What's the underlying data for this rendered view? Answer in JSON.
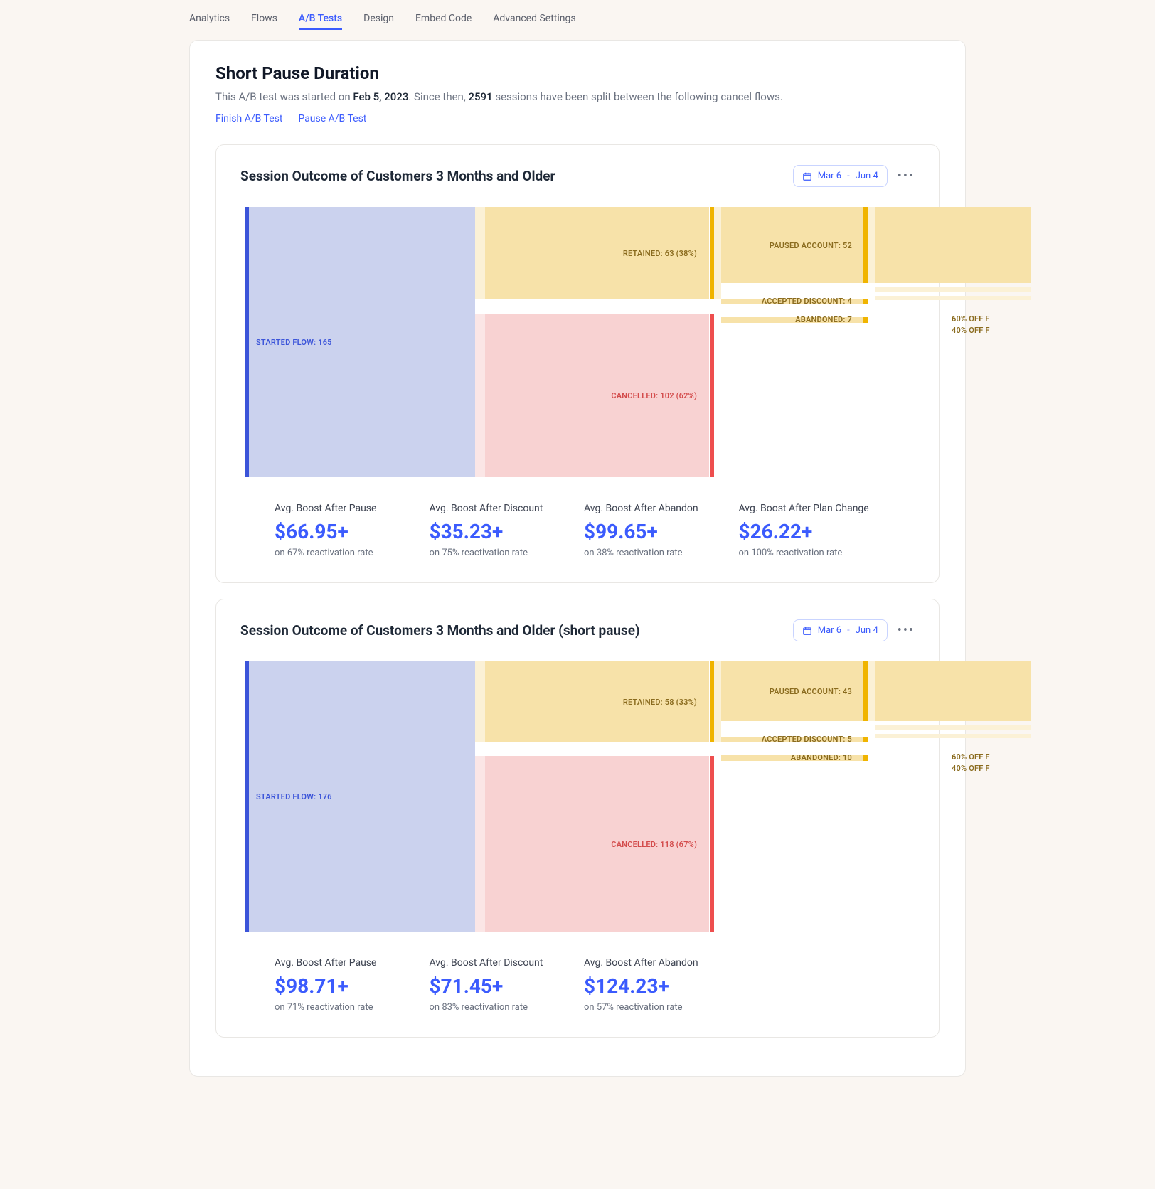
{
  "tabs": {
    "analytics": "Analytics",
    "flows": "Flows",
    "ab_tests": "A/B Tests",
    "design": "Design",
    "embed": "Embed Code",
    "advanced": "Advanced Settings"
  },
  "header": {
    "title": "Short Pause Duration",
    "sub_prefix": "This A/B test was started on ",
    "start_date": "Feb 5, 2023",
    "sub_mid": ". Since then, ",
    "session_count": "2591",
    "sub_suffix": " sessions have been split between the following cancel flows."
  },
  "actions": {
    "finish": "Finish A/B Test",
    "pause": "Pause A/B Test"
  },
  "date_range": {
    "from": "Mar 6",
    "to": "Jun 4",
    "dash": "-"
  },
  "chart_data": [
    {
      "type": "sankey",
      "title": "Session Outcome of Customers 3 Months and Older",
      "started": {
        "label": "STARTED FLOW",
        "value": 165
      },
      "retained": {
        "label": "RETAINED",
        "value": 63,
        "pct": 38
      },
      "cancelled": {
        "label": "CANCELLED",
        "value": 102,
        "pct": 62
      },
      "paused": {
        "label": "PAUSED ACCOUNT",
        "value": 52
      },
      "discount": {
        "label": "ACCEPTED DISCOUNT",
        "value": 4
      },
      "abandoned": {
        "label": "ABANDONED",
        "value": 7
      },
      "offers": {
        "a": "60% OFF F",
        "b": "40% OFF F"
      },
      "boosts": [
        {
          "label": "Avg. Boost After Pause",
          "value": "$66.95+",
          "sub": "on 67% reactivation rate"
        },
        {
          "label": "Avg. Boost After Discount",
          "value": "$35.23+",
          "sub": "on 75% reactivation rate"
        },
        {
          "label": "Avg. Boost After Abandon",
          "value": "$99.65+",
          "sub": "on 38% reactivation rate"
        },
        {
          "label": "Avg. Boost After Plan Change",
          "value": "$26.22+",
          "sub": "on 100% reactivation rate"
        }
      ]
    },
    {
      "type": "sankey",
      "title": "Session Outcome of Customers 3 Months and Older (short pause)",
      "started": {
        "label": "STARTED FLOW",
        "value": 176
      },
      "retained": {
        "label": "RETAINED",
        "value": 58,
        "pct": 33
      },
      "cancelled": {
        "label": "CANCELLED",
        "value": 118,
        "pct": 67
      },
      "paused": {
        "label": "PAUSED ACCOUNT",
        "value": 43
      },
      "discount": {
        "label": "ACCEPTED DISCOUNT",
        "value": 5
      },
      "abandoned": {
        "label": "ABANDONED",
        "value": 10
      },
      "offers": {
        "a": "60% OFF F",
        "b": "40% OFF F"
      },
      "boosts": [
        {
          "label": "Avg. Boost After Pause",
          "value": "$98.71+",
          "sub": "on 71% reactivation rate"
        },
        {
          "label": "Avg. Boost After Discount",
          "value": "$71.45+",
          "sub": "on 83% reactivation rate"
        },
        {
          "label": "Avg. Boost After Abandon",
          "value": "$124.23+",
          "sub": "on 57% reactivation rate"
        }
      ]
    }
  ]
}
